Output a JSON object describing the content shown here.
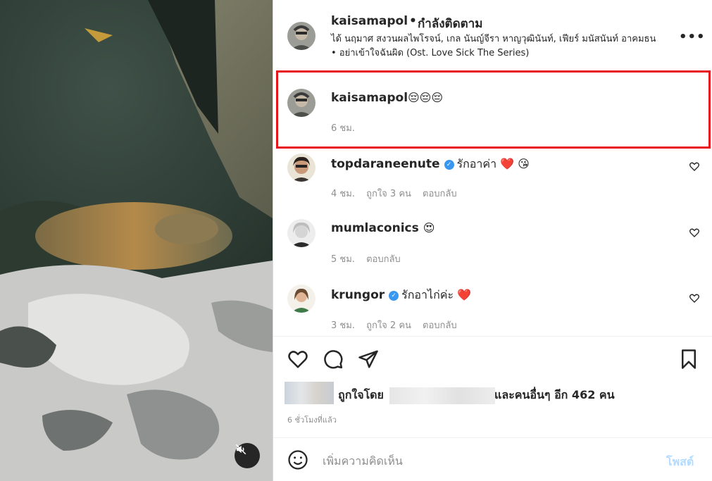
{
  "post": {
    "author": "kaisamapol",
    "separator": "•",
    "follow_status": "กำลังติดตาม",
    "audio_line": "ได้ นฤมาศ สงวนผลไพโรจน์, เกล นันญ์จีรา หาญวุฒินันท์, เฟียร์ มนัสนันท์ อาคมธน • อย่าเข้าใจฉันผิด (Ost. Love Sick The Series)",
    "more_label": "•••"
  },
  "caption": {
    "user": "kaisamapol",
    "text": "😔😔😔",
    "time": "6 ชม."
  },
  "comments": [
    {
      "user": "topdaraneenute",
      "verified": true,
      "text": "รักอาค่า ❤️ 😘",
      "time": "4 ชม.",
      "likes": "ถูกใจ 3 คน",
      "reply": "ตอบกลับ"
    },
    {
      "user": "mumlaconics",
      "verified": false,
      "text": "😍",
      "time": "5 ชม.",
      "likes": "",
      "reply": "ตอบกลับ"
    },
    {
      "user": "krungor",
      "verified": true,
      "text": "รักอาไก่ค่ะ ❤️",
      "time": "3 ชม.",
      "likes": "ถูกใจ 2 คน",
      "reply": "ตอบกลับ"
    }
  ],
  "likes": {
    "prefix": "ถูกใจโดย",
    "suffix": "และคนอื่นๆ อีก 462 คน"
  },
  "time_ago": "6 ชั่วโมงที่แล้ว",
  "composer": {
    "placeholder": "เพิ่มความคิดเห็น",
    "post_label": "โพสต์"
  },
  "colors": {
    "highlight": "#e8141c",
    "verified": "#3897f0",
    "post_disabled": "#b3dbff"
  },
  "icons": [
    "mute-icon",
    "heart-icon",
    "comment-icon",
    "share-icon",
    "bookmark-icon",
    "emoji-icon",
    "verified-icon"
  ]
}
